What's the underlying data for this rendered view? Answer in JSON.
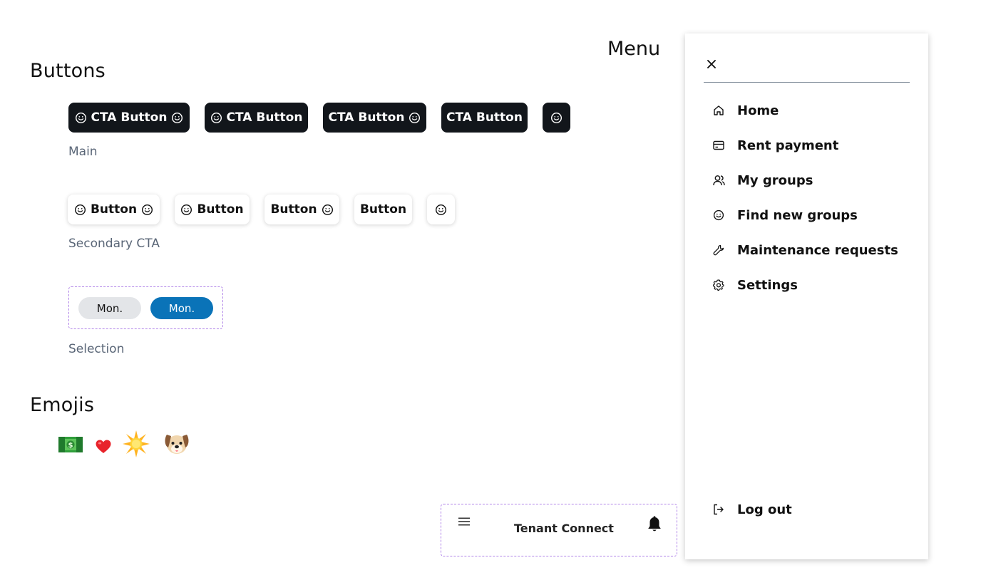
{
  "sections": {
    "buttons_heading": "Buttons",
    "emojis_heading": "Emojis",
    "menu_heading": "Menu"
  },
  "main_buttons": {
    "label": "CTA Button",
    "caption": "Main"
  },
  "secondary_buttons": {
    "label": "Button",
    "caption": "Secondary CTA"
  },
  "selection": {
    "option_unselected": "Mon.",
    "option_selected": "Mon.",
    "caption": "Selection"
  },
  "emojis": [
    "money-emoji",
    "heart-emoji",
    "sun-emoji",
    "dog-emoji"
  ],
  "navbar": {
    "title": "Tenant Connect"
  },
  "menu": {
    "items": [
      {
        "label": "Home",
        "icon": "home-icon"
      },
      {
        "label": "Rent payment",
        "icon": "credit-card-icon"
      },
      {
        "label": "My groups",
        "icon": "users-icon"
      },
      {
        "label": "Find new groups",
        "icon": "smile-icon"
      },
      {
        "label": "Maintenance requests",
        "icon": "wrench-icon"
      },
      {
        "label": "Settings",
        "icon": "gear-icon"
      }
    ],
    "logout_label": "Log out"
  },
  "colors": {
    "dark_button": "#12161b",
    "selected_pill": "#0a73b8",
    "unselected_pill": "#e3e5e8",
    "caption_text": "#5a6677",
    "dashed_outline": "#b083e8"
  }
}
